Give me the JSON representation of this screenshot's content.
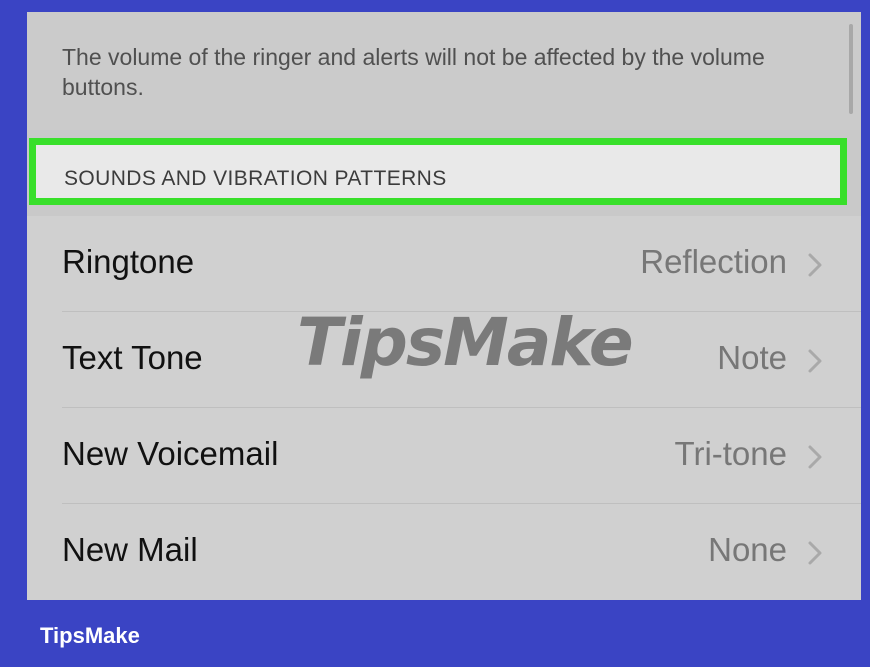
{
  "footer_text": "The volume of the ringer and alerts will not be affected by the volume buttons.",
  "section": {
    "title": "SOUNDS AND VIBRATION PATTERNS"
  },
  "rows": [
    {
      "label": "Ringtone",
      "value": "Reflection"
    },
    {
      "label": "Text Tone",
      "value": "Note"
    },
    {
      "label": "New Voicemail",
      "value": "Tri-tone"
    },
    {
      "label": "New Mail",
      "value": "None"
    }
  ],
  "watermark": {
    "text": "TipsMake"
  },
  "brand": {
    "label": "TipsMake"
  },
  "colors": {
    "frame": "#3a44c4",
    "highlight": "#38df2a",
    "screen": "#c9c9c9"
  },
  "icons": [
    "chevron-right-icon"
  ]
}
